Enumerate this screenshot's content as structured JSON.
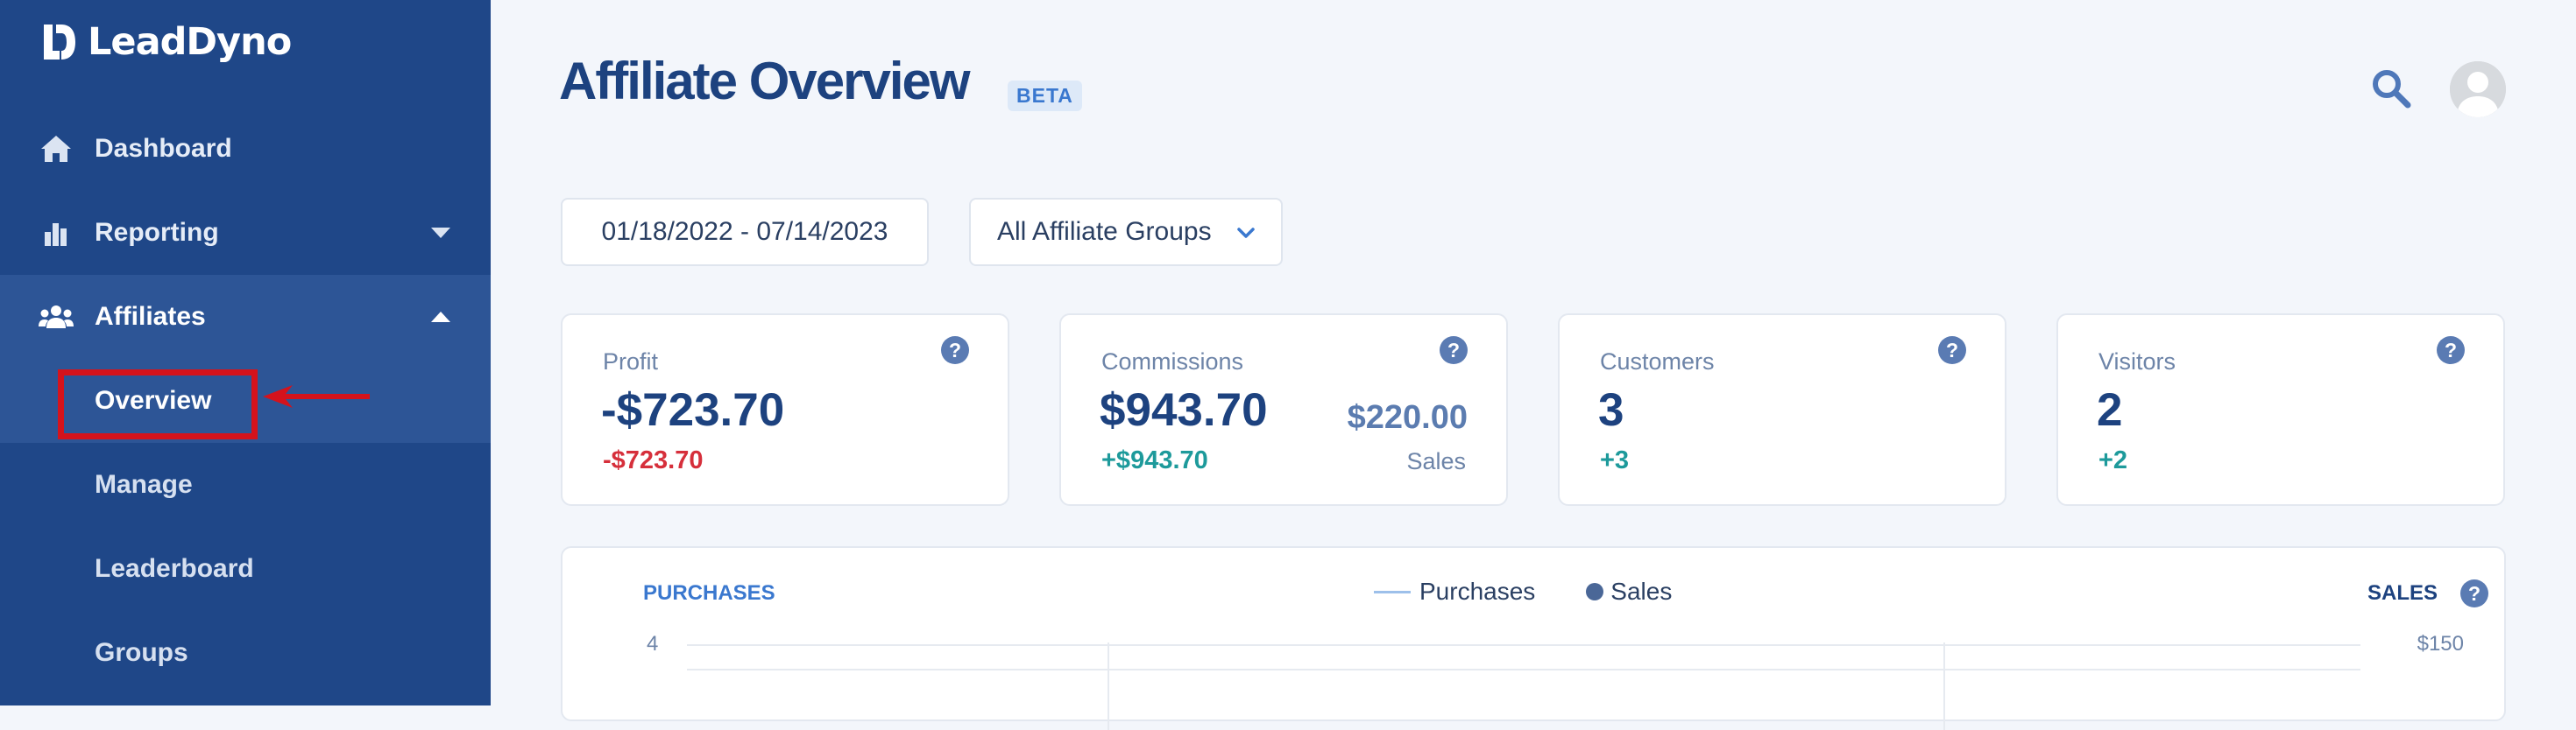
{
  "brand": {
    "name": "LeadDyno"
  },
  "sidebar": {
    "items": [
      {
        "label": "Dashboard",
        "icon": "home-icon"
      },
      {
        "label": "Reporting",
        "icon": "bar-chart-icon",
        "caret": "down"
      },
      {
        "label": "Affiliates",
        "icon": "users-icon",
        "caret": "up"
      }
    ],
    "affiliates_sub": [
      {
        "label": "Overview",
        "active": true
      },
      {
        "label": "Manage"
      },
      {
        "label": "Leaderboard"
      },
      {
        "label": "Groups"
      }
    ]
  },
  "header": {
    "title": "Affiliate Overview",
    "badge": "BETA"
  },
  "filters": {
    "date_range": "01/18/2022 - 07/14/2023",
    "group": "All Affiliate Groups"
  },
  "cards": [
    {
      "label": "Profit",
      "value": "-$723.70",
      "delta": "-$723.70",
      "delta_sign": "negative"
    },
    {
      "label": "Commissions",
      "value": "$943.70",
      "delta": "+$943.70",
      "delta_sign": "positive",
      "sub_value": "$220.00",
      "sub_label": "Sales"
    },
    {
      "label": "Customers",
      "value": "3",
      "delta": "+3",
      "delta_sign": "positive"
    },
    {
      "label": "Visitors",
      "value": "2",
      "delta": "+2",
      "delta_sign": "positive"
    }
  ],
  "chart": {
    "left_axis_title": "PURCHASES",
    "right_axis_title": "SALES",
    "legend": {
      "purchases": "Purchases",
      "sales": "Sales"
    },
    "left_top_tick": "4",
    "right_top_tick": "$150"
  },
  "colors": {
    "sidebar": "#1f4788",
    "accent_blue": "#3a78cf",
    "positive": "#1d9a9b",
    "negative": "#d62f3b",
    "annotation": "#d4131c"
  }
}
